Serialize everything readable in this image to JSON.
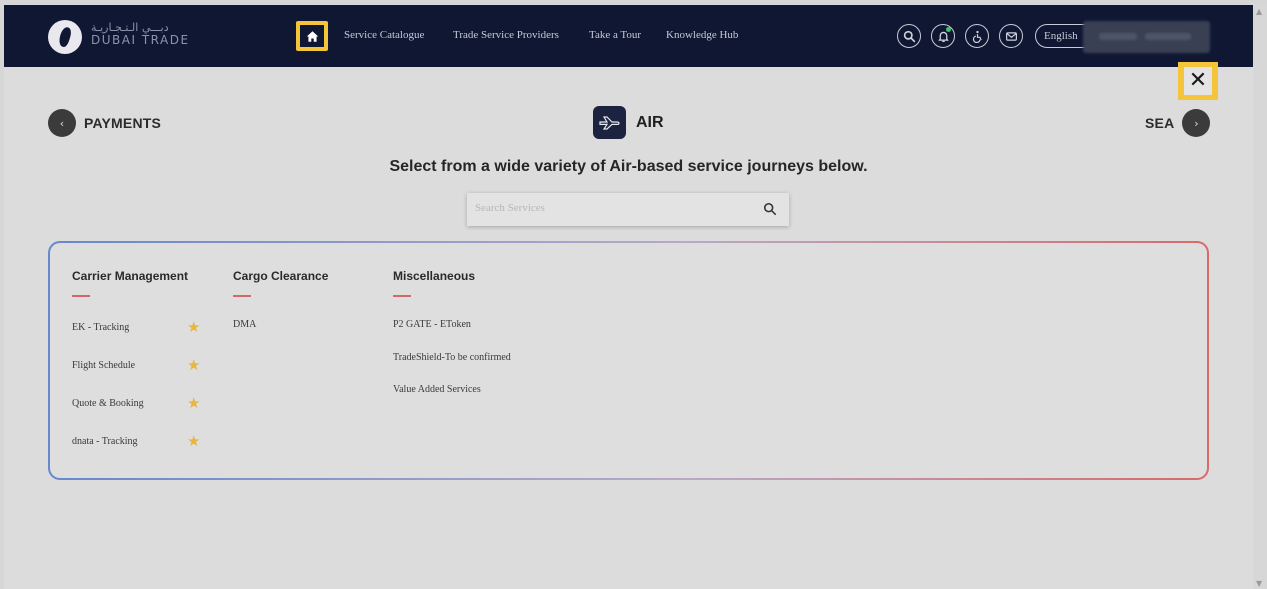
{
  "header": {
    "brand_ar": "دبـــي الـتـجـاريـة",
    "brand_en": "DUBAI TRADE",
    "nav": [
      "Service Catalogue",
      "Trade Service Providers",
      "Take a Tour",
      "Knowledge Hub"
    ],
    "language": "English"
  },
  "icons": {
    "home": "home-icon",
    "search": "search-icon",
    "notifications": "bell-icon",
    "accessibility": "wheelchair-icon",
    "mail": "mail-icon",
    "close": "close-icon"
  },
  "close_label": "✕",
  "prev": {
    "label": "PAYMENTS",
    "arrow": "‹"
  },
  "next": {
    "label": "SEA",
    "arrow": "›"
  },
  "section": {
    "title": "AIR"
  },
  "tagline": "Select from a wide variety of Air-based service journeys below.",
  "search": {
    "placeholder": "Search Services",
    "value": ""
  },
  "columns": [
    {
      "title": "Carrier Management",
      "items": [
        "EK - Tracking",
        "Flight Schedule",
        "Quote & Booking",
        "dnata - Tracking"
      ],
      "starred": [
        true,
        true,
        true,
        true
      ]
    },
    {
      "title": "Cargo Clearance",
      "items": [
        "DMA"
      ]
    },
    {
      "title": "Miscellaneous",
      "items": [
        "P2 GATE - EToken",
        "TradeShield-To be confirmed",
        "Value Added Services"
      ]
    }
  ],
  "colors": {
    "navbar": "#0f1733",
    "highlight": "#f4c43a",
    "star": "#e9b53a",
    "accent_red": "#d06a6a",
    "accent_blue": "#6688cc"
  }
}
